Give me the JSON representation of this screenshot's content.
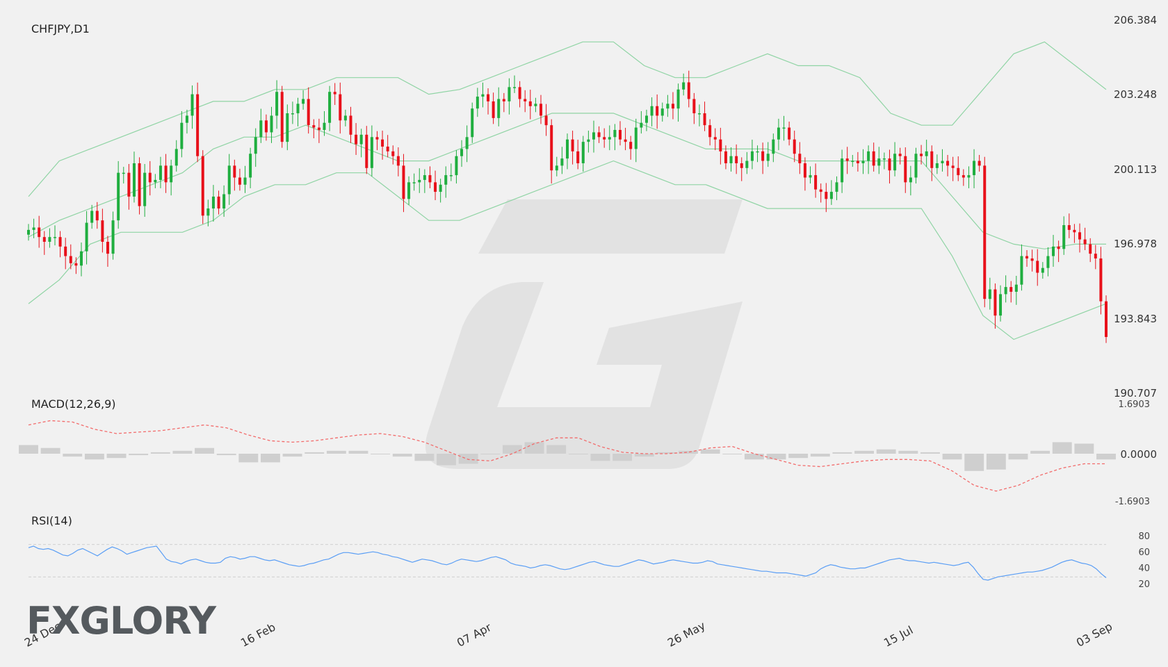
{
  "symbol_label": "CHFJPY,D1",
  "macd_label": "MACD(12,26,9)",
  "rsi_label": "RSI(14)",
  "brand": {
    "text": "FXGLORY",
    "accent_color": "#e8772e"
  },
  "watermark_icon": "fxglory-g-watermark",
  "colors": {
    "up": "#1fae3f",
    "down": "#e8101a",
    "bands": "#8fd4a4",
    "macd_signal": "#f26b6b",
    "rsi": "#5a9ef5",
    "histogram": "#cfcfcf"
  },
  "chart_data": [
    {
      "type": "candlestick",
      "title": "CHFJPY,D1",
      "y_ticks": [
        "206.384",
        "203.248",
        "200.113",
        "196.978",
        "193.843",
        "190.707"
      ],
      "ylim": [
        190.707,
        206.384
      ],
      "x_ticks": [
        "24 Dec",
        "16 Feb",
        "07 Apr",
        "26 May",
        "15 Jul",
        "03 Sep"
      ],
      "indicator": "bollinger_bands",
      "close": [
        197.6,
        197.7,
        197.3,
        197.1,
        197.3,
        197.3,
        196.9,
        196.5,
        196.2,
        196.1,
        196.7,
        197.9,
        198.4,
        198.0,
        197.1,
        196.6,
        198.0,
        200.0,
        200.0,
        199.0,
        200.4,
        198.6,
        200.0,
        199.6,
        199.7,
        200.3,
        199.6,
        200.3,
        201.0,
        202.1,
        202.4,
        203.3,
        200.7,
        198.2,
        198.5,
        199.0,
        198.5,
        199.1,
        200.3,
        199.8,
        199.5,
        199.8,
        200.8,
        201.5,
        202.2,
        201.7,
        202.4,
        203.4,
        201.3,
        202.5,
        202.5,
        202.9,
        203.1,
        202.0,
        201.9,
        201.8,
        202.1,
        203.4,
        203.3,
        202.2,
        202.4,
        201.6,
        201.2,
        201.6,
        200.2,
        201.5,
        201.4,
        201.1,
        200.9,
        200.7,
        200.3,
        198.9,
        199.6,
        199.6,
        199.7,
        199.9,
        199.6,
        199.2,
        199.5,
        199.9,
        199.9,
        200.7,
        201.0,
        201.5,
        202.7,
        203.2,
        203.3,
        203.0,
        202.3,
        203.1,
        203.0,
        203.6,
        203.6,
        203.1,
        203.0,
        202.8,
        202.9,
        202.4,
        202.0,
        200.1,
        200.3,
        200.6,
        201.4,
        200.9,
        200.4,
        201.3,
        201.4,
        201.7,
        201.5,
        201.4,
        201.5,
        201.8,
        201.4,
        201.3,
        201.0,
        201.9,
        202.1,
        202.4,
        202.8,
        202.4,
        202.7,
        202.9,
        202.7,
        203.5,
        203.8,
        203.1,
        202.5,
        202.5,
        202.0,
        201.5,
        201.4,
        200.9,
        200.4,
        200.7,
        200.4,
        200.2,
        200.5,
        200.9,
        200.9,
        200.5,
        200.8,
        201.4,
        201.9,
        201.9,
        201.4,
        200.8,
        200.4,
        199.8,
        199.9,
        199.3,
        199.2,
        198.9,
        199.2,
        199.6,
        200.6,
        200.5,
        200.5,
        200.4,
        200.5,
        200.9,
        200.3,
        200.6,
        200.6,
        200.1,
        200.8,
        200.7,
        199.6,
        199.8,
        200.8,
        200.7,
        200.9,
        200.2,
        200.4,
        200.5,
        200.3,
        200.2,
        199.9,
        199.8,
        199.9,
        200.5,
        200.3,
        194.7,
        195.1,
        194.0,
        194.9,
        195.2,
        195.0,
        195.3,
        196.5,
        196.4,
        196.3,
        195.8,
        196.0,
        196.5,
        196.9,
        196.8,
        197.8,
        197.6,
        197.5,
        197.2,
        197.0,
        196.6,
        196.4,
        194.6,
        193.1
      ],
      "bands": {
        "upper_curve_approx": [
          199,
          200.5,
          201,
          201.5,
          202,
          202.5,
          203,
          203,
          203.5,
          203.5,
          204,
          204,
          204,
          203.3,
          203.5,
          204,
          204.5,
          205,
          205.5,
          205.5,
          204.5,
          204,
          204,
          204.5,
          205,
          204.5,
          204.5,
          204,
          202.5,
          202,
          202,
          203.5,
          205,
          205.5,
          204.5,
          203.5
        ],
        "middle_curve_approx": [
          197.3,
          198,
          198.5,
          199,
          199.5,
          200,
          201,
          201.5,
          201.5,
          202,
          201.5,
          201,
          200.5,
          200.5,
          201,
          201.5,
          202,
          202.5,
          202.5,
          202.5,
          202,
          201.5,
          201,
          201,
          201,
          200.5,
          200.5,
          200.5,
          200.5,
          200.5,
          199,
          197.5,
          197,
          196.8,
          197,
          197
        ],
        "lower_curve_approx": [
          194.5,
          195.5,
          197,
          197.5,
          197.5,
          197.5,
          198,
          199,
          199.5,
          199.5,
          200,
          200,
          199,
          198,
          198,
          198.5,
          199,
          199.5,
          200,
          200.5,
          200,
          199.5,
          199.5,
          199,
          198.5,
          198.5,
          198.5,
          198.5,
          198.5,
          198.5,
          196.5,
          194,
          193,
          193.5,
          194,
          194.5
        ]
      }
    },
    {
      "type": "line",
      "title": "MACD(12,26,9)",
      "y_ticks": [
        "1.6903",
        "0.0000",
        "-1.6903"
      ],
      "ylim": [
        -1.6903,
        1.6903
      ],
      "series": [
        {
          "name": "signal",
          "values": [
            1.0,
            1.15,
            1.1,
            0.85,
            0.7,
            0.75,
            0.8,
            0.9,
            1.0,
            0.9,
            0.65,
            0.45,
            0.4,
            0.45,
            0.55,
            0.65,
            0.7,
            0.6,
            0.4,
            0.1,
            -0.2,
            -0.25,
            0.0,
            0.35,
            0.55,
            0.55,
            0.25,
            0.05,
            0.0,
            0.0,
            0.05,
            0.2,
            0.25,
            0.0,
            -0.2,
            -0.4,
            -0.45,
            -0.35,
            -0.25,
            -0.2,
            -0.2,
            -0.25,
            -0.6,
            -1.1,
            -1.3,
            -1.1,
            -0.75,
            -0.5,
            -0.35,
            -0.35
          ]
        },
        {
          "name": "histogram",
          "values": [
            0.3,
            0.2,
            -0.1,
            -0.2,
            -0.15,
            -0.05,
            0.05,
            0.1,
            0.2,
            -0.05,
            -0.3,
            -0.3,
            -0.1,
            0.05,
            0.1,
            0.1,
            0.0,
            -0.1,
            -0.25,
            -0.4,
            -0.35,
            0.0,
            0.3,
            0.4,
            0.3,
            0.0,
            -0.25,
            -0.25,
            -0.1,
            0.05,
            0.1,
            0.15,
            0.0,
            -0.2,
            -0.2,
            -0.15,
            -0.1,
            0.05,
            0.1,
            0.15,
            0.1,
            0.05,
            -0.2,
            -0.6,
            -0.55,
            -0.2,
            0.1,
            0.4,
            0.35,
            -0.2
          ]
        }
      ]
    },
    {
      "type": "line",
      "title": "RSI(14)",
      "y_ticks": [
        "80",
        "60",
        "40",
        "20"
      ],
      "ylim": [
        20,
        80
      ],
      "levels": [
        70,
        30
      ],
      "values": [
        66,
        68,
        65,
        64,
        65,
        63,
        60,
        57,
        56,
        59,
        63,
        65,
        62,
        59,
        56,
        60,
        64,
        67,
        65,
        62,
        58,
        60,
        62,
        64,
        66,
        67,
        68,
        60,
        52,
        49,
        48,
        46,
        49,
        51,
        52,
        50,
        48,
        47,
        47,
        48,
        53,
        55,
        54,
        52,
        53,
        55,
        55,
        53,
        51,
        50,
        51,
        49,
        47,
        45,
        44,
        43,
        44,
        46,
        47,
        49,
        51,
        52,
        55,
        58,
        60,
        60,
        59,
        58,
        59,
        60,
        61,
        60,
        58,
        57,
        55,
        54,
        52,
        50,
        48,
        50,
        52,
        51,
        50,
        48,
        46,
        45,
        47,
        50,
        52,
        51,
        50,
        49,
        50,
        52,
        54,
        55,
        53,
        51,
        47,
        45,
        44,
        43,
        41,
        42,
        44,
        45,
        44,
        42,
        40,
        39,
        40,
        42,
        44,
        46,
        48,
        49,
        47,
        45,
        44,
        43,
        43,
        45,
        47,
        49,
        51,
        50,
        48,
        46,
        47,
        48,
        50,
        51,
        50,
        49,
        48,
        47,
        47,
        48,
        50,
        49,
        46,
        45,
        44,
        43,
        42,
        41,
        40,
        39,
        38,
        37,
        37,
        36,
        35,
        35,
        35,
        34,
        33,
        32,
        31,
        33,
        35,
        40,
        43,
        45,
        44,
        42,
        41,
        40,
        40,
        41,
        41,
        43,
        45,
        47,
        49,
        51,
        52,
        53,
        51,
        50,
        50,
        49,
        48,
        47,
        48,
        47,
        46,
        45,
        44,
        45,
        47,
        48,
        42,
        34,
        27,
        26,
        28,
        30,
        31,
        32,
        33,
        34,
        35,
        36,
        36,
        37,
        38,
        40,
        42,
        45,
        48,
        50,
        51,
        49,
        47,
        46,
        44,
        40,
        34,
        29
      ]
    }
  ]
}
